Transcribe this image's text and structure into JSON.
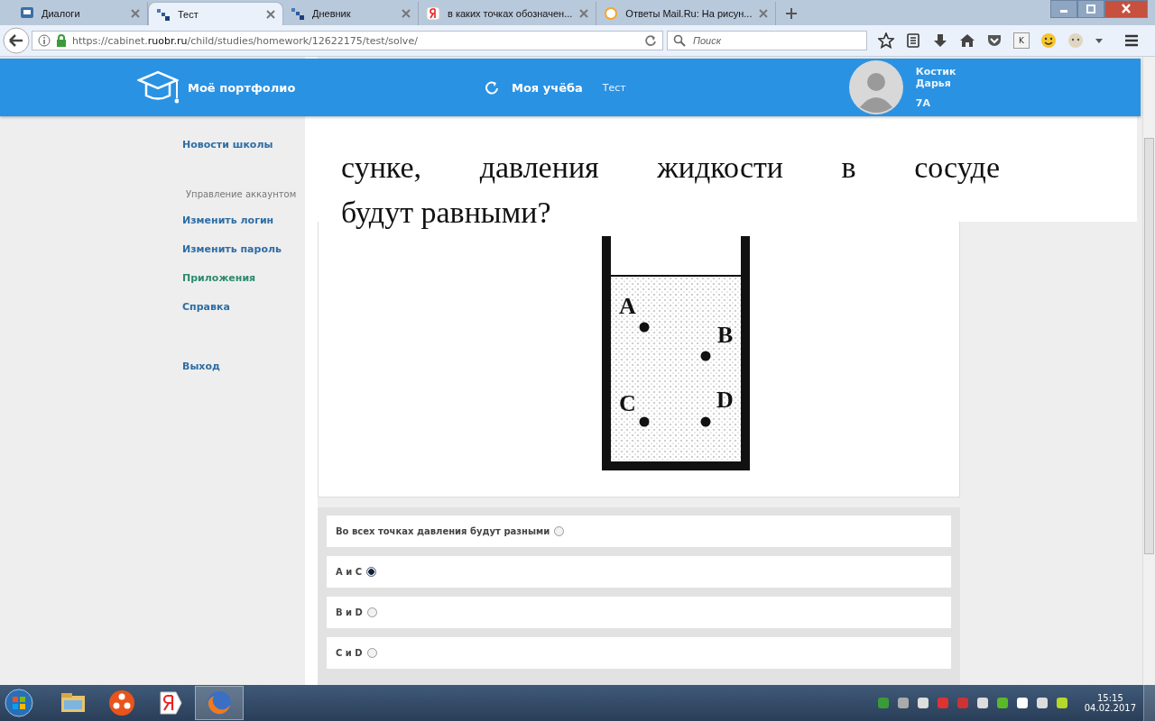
{
  "browser": {
    "tabs": [
      {
        "label": "Диалоги",
        "selected": false
      },
      {
        "label": "Тест",
        "selected": true
      },
      {
        "label": "Дневник",
        "selected": false
      },
      {
        "label": "в каких точках обозначен...",
        "selected": false
      },
      {
        "label": "Ответы Mail.Ru: На рисун...",
        "selected": false
      }
    ],
    "url": "https://cabinet.**ruobr.ru**/child/studies/homework/12622175/test/solve/",
    "search": {
      "placeholder": "Поиск"
    },
    "k_button": "K"
  },
  "header": {
    "brand": "Моё портфолио",
    "nav": [
      {
        "label": "Моя учёба",
        "kind": "main"
      },
      {
        "label": "Тест",
        "kind": "sub"
      }
    ],
    "user": {
      "surname": "Костик",
      "name": "Дарья",
      "class": "7А"
    }
  },
  "sidebar": {
    "items": [
      {
        "label": "Новости школы",
        "kind": "link",
        "color": "#2e6da4"
      },
      {
        "label": "Управление аккаунтом",
        "kind": "heading",
        "color": "#777777"
      },
      {
        "label": "Изменить логин",
        "kind": "link",
        "color": "#2e6da4"
      },
      {
        "label": "Изменить пароль",
        "kind": "link",
        "color": "#2e6da4"
      },
      {
        "label": "Приложения",
        "kind": "link",
        "color": "#2e8a6e"
      },
      {
        "label": "Справка",
        "kind": "link",
        "color": "#2e6da4"
      },
      {
        "label": "Выход",
        "kind": "exit",
        "color": "#2e6da4"
      }
    ]
  },
  "question": {
    "lines": [
      "сунке, давления жидкости в сосуде",
      "будут равными?"
    ],
    "figure": {
      "points": [
        "A",
        "B",
        "C",
        "D"
      ]
    }
  },
  "answers": [
    {
      "label": "Во всех точках давления будут разными",
      "selected": false
    },
    {
      "label": "A и C",
      "selected": true
    },
    {
      "label": "B и D",
      "selected": false
    },
    {
      "label": "C и D",
      "selected": false
    }
  ],
  "taskbar": {
    "time": "15:15",
    "date": "04.02.2017"
  }
}
